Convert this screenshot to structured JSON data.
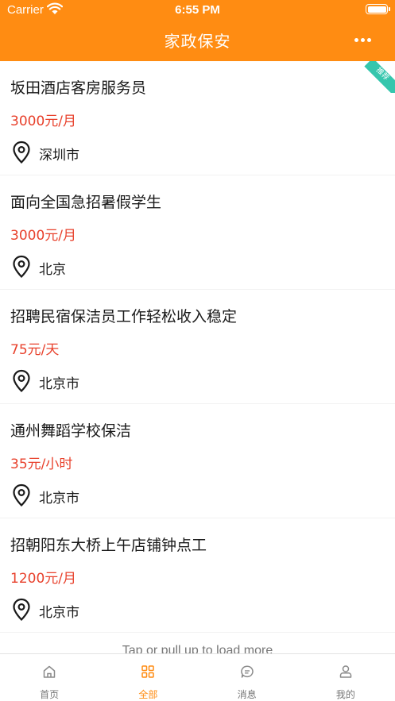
{
  "status_bar": {
    "carrier": "Carrier",
    "time": "6:55 PM"
  },
  "nav": {
    "title": "家政保安",
    "more_icon": "more-icon"
  },
  "jobs": [
    {
      "title": "坂田酒店客房服务员",
      "salary": "3000元/月",
      "location": "深圳市",
      "badge": "推荐"
    },
    {
      "title": "面向全国急招暑假学生",
      "salary": "3000元/月",
      "location": "北京"
    },
    {
      "title": "招聘民宿保洁员工作轻松收入稳定",
      "salary": "75元/天",
      "location": "北京市"
    },
    {
      "title": "通州舞蹈学校保洁",
      "salary": "35元/小时",
      "location": "北京市"
    },
    {
      "title": "招朝阳东大桥上午店铺钟点工",
      "salary": "1200元/月",
      "location": "北京市"
    }
  ],
  "load_more": "Tap or pull up to load more",
  "tabs": [
    {
      "label": "首页",
      "icon": "home-icon",
      "active": false
    },
    {
      "label": "全部",
      "icon": "grid-icon",
      "active": true
    },
    {
      "label": "消息",
      "icon": "message-icon",
      "active": false
    },
    {
      "label": "我的",
      "icon": "user-icon",
      "active": false
    }
  ],
  "colors": {
    "primary": "#ff8c12",
    "salary": "#e8412c",
    "badge": "#35c6ad"
  }
}
